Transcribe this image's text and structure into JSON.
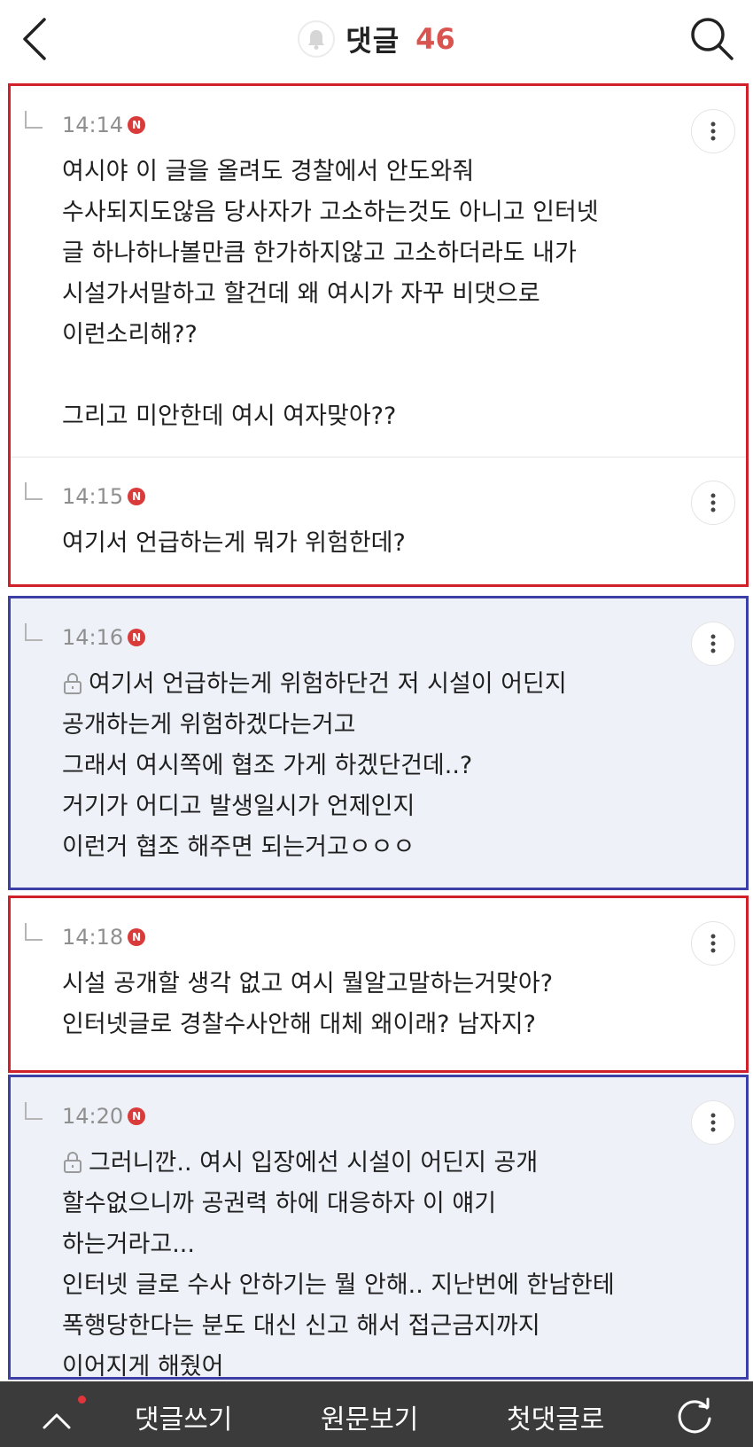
{
  "header": {
    "title": "댓글",
    "count": "46"
  },
  "comments": [
    {
      "time": "14:14",
      "badge": "N",
      "locked": false,
      "body": "여시야 이 글을 올려도 경찰에서 안도와줘\n수사되지도않음 당사자가 고소하는것도 아니고 인터넷\n글 하나하나볼만큼 한가하지않고 고소하더라도 내가\n시설가서말하고 할건데 왜 여시가 자꾸 비댓으로\n이런소리해??\n\n그리고 미안한데 여시 여자맞아??"
    },
    {
      "time": "14:15",
      "badge": "N",
      "locked": false,
      "body": "여기서 언급하는게 뭐가 위험한데?"
    },
    {
      "time": "14:16",
      "badge": "N",
      "locked": true,
      "body": "여기서 언급하는게 위험하단건 저 시설이 어딘지\n공개하는게 위험하겠다는거고\n그래서 여시쪽에 협조 가게 하겠단건데..?\n거기가 어디고 발생일시가 언제인지\n이런거 협조 해주면 되는거고ㅇㅇㅇ"
    },
    {
      "time": "14:18",
      "badge": "N",
      "locked": false,
      "body": "시설 공개할 생각 없고 여시 뭘알고말하는거맞아?\n인터넷글로 경찰수사안해 대체 왜이래? 남자지?"
    },
    {
      "time": "14:20",
      "badge": "N",
      "locked": true,
      "body": "그러니깐.. 여시 입장에선 시설이 어딘지 공개\n할수없으니까 공권력 하에 대응하자 이 얘기\n하는거라고...\n인터넷 글로 수사 안하기는 뭘 안해.. 지난번에 한남한테\n폭행당한다는 분도 대신 신고 해서 접근금지까지\n이어지게 해줬어"
    }
  ],
  "bottom_bar": {
    "write": "댓글쓰기",
    "view_original": "원문보기",
    "first_comment": "첫댓글로"
  },
  "icons": {
    "back": "chevron-left-icon",
    "search": "search-icon",
    "bell": "bell-icon",
    "more": "more-vertical-icon",
    "lock": "lock-icon",
    "up": "chevron-up-icon",
    "refresh": "refresh-icon"
  },
  "colors": {
    "accent_red": "#d9534f",
    "group_red": "#d0212b",
    "group_blue": "#3c3fa6",
    "bottom_bar": "#3b3b3b"
  }
}
